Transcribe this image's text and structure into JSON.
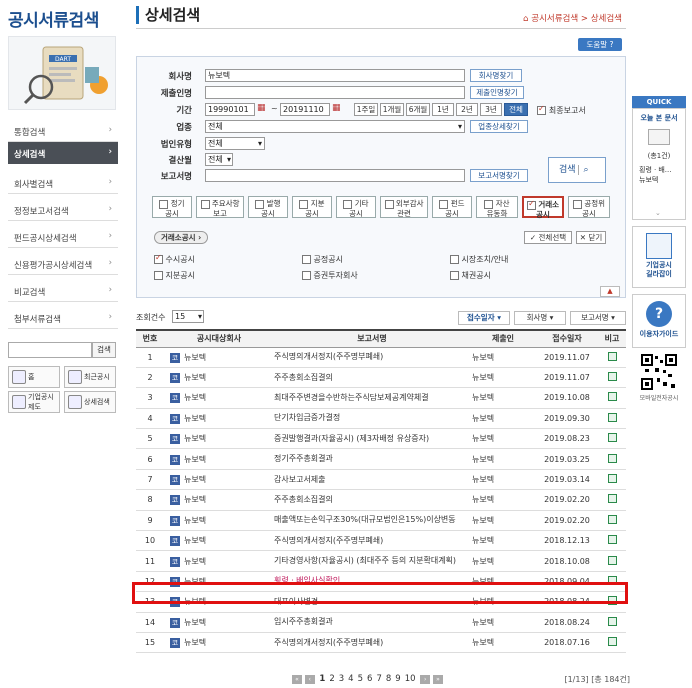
{
  "sidebar": {
    "title": "공시서류검색",
    "logo_text": "DART",
    "items": [
      {
        "label": "통합검색"
      },
      {
        "label": "상세검색"
      },
      {
        "label": "회사별검색"
      },
      {
        "label": "정정보고서검색"
      },
      {
        "label": "펀드공시상세검색"
      },
      {
        "label": "신용평가공시상세검색"
      },
      {
        "label": "비교검색"
      },
      {
        "label": "첨부서류검색"
      }
    ],
    "search_button": "검색",
    "quick_links": [
      {
        "label": "홈"
      },
      {
        "label": "최근공시"
      },
      {
        "label": "기업공시제도"
      },
      {
        "label": "상세검색"
      }
    ]
  },
  "header": {
    "title": "상세검색",
    "breadcrumb": "공시서류검색 > 상세검색",
    "help_button": "도움말"
  },
  "form": {
    "company_label": "회사명",
    "company_value": "뉴보텍",
    "company_search_btn": "회사명찾기",
    "submitter_label": "제출인명",
    "submitter_value": "",
    "submitter_search_btn": "제출인명찾기",
    "period_label": "기간",
    "date_from": "19990101",
    "date_sep": "~",
    "date_to": "20191110",
    "period_buttons": [
      "1주일",
      "1개월",
      "6개월",
      "1년",
      "2년",
      "3년",
      "전체"
    ],
    "latest_report_label": "최종보고서",
    "industry_label": "업종",
    "industry_value": "전체",
    "industry_btn": "업종상세찾기",
    "corp_type_label": "법인유형",
    "corp_type_value": "전체",
    "fiscal_label": "결산월",
    "fiscal_value": "전체",
    "report_label": "보고서명",
    "report_value": "",
    "report_btn": "보고서명찾기",
    "search_button": "검색",
    "types": [
      {
        "label": "정기\n공시"
      },
      {
        "label": "주요사항\n보고"
      },
      {
        "label": "발행\n공시"
      },
      {
        "label": "지분\n공시"
      },
      {
        "label": "기타\n공시"
      },
      {
        "label": "외부감사\n관련"
      },
      {
        "label": "펀드\n공시"
      },
      {
        "label": "자산\n유동화"
      },
      {
        "label": "거래소\n공시"
      },
      {
        "label": "공정위\n공시"
      }
    ],
    "exchange_tag": "거래소공시",
    "select_all": "전체선택",
    "close": "닫기",
    "sub_options": [
      "수시공시",
      "공정공시",
      "시장조치/안내",
      "지분공시",
      "증권투자회사",
      "채권공시"
    ]
  },
  "list": {
    "count_label": "조회건수",
    "count_value": "15",
    "sort_buttons": [
      "접수일자",
      "회사명",
      "보고서명"
    ],
    "columns": [
      "번호",
      "공시대상회사",
      "보고서명",
      "제출인",
      "접수일자",
      "비고"
    ],
    "badge": "코",
    "rows": [
      {
        "no": "1",
        "company": "뉴보텍",
        "report": "주식명의개서정지(주주명부폐쇄)",
        "submitter": "뉴보텍",
        "date": "2019.11.07"
      },
      {
        "no": "2",
        "company": "뉴보텍",
        "report": "주주총회소집결의",
        "submitter": "뉴보텍",
        "date": "2019.11.07"
      },
      {
        "no": "3",
        "company": "뉴보텍",
        "report": "최대주주변경을수반하는주식담보제공계약체결",
        "submitter": "뉴보텍",
        "date": "2019.10.08"
      },
      {
        "no": "4",
        "company": "뉴보텍",
        "report": "단기차입금증가결정",
        "submitter": "뉴보텍",
        "date": "2019.09.30"
      },
      {
        "no": "5",
        "company": "뉴보텍",
        "report": "증권발행결과(자율공시) (제3자배정 유상증자)",
        "submitter": "뉴보텍",
        "date": "2019.08.23"
      },
      {
        "no": "6",
        "company": "뉴보텍",
        "report": "정기주주총회결과",
        "submitter": "뉴보텍",
        "date": "2019.03.25"
      },
      {
        "no": "7",
        "company": "뉴보텍",
        "report": "감사보고서제출",
        "submitter": "뉴보텍",
        "date": "2019.03.14"
      },
      {
        "no": "8",
        "company": "뉴보텍",
        "report": "주주총회소집결의",
        "submitter": "뉴보텍",
        "date": "2019.02.20"
      },
      {
        "no": "9",
        "company": "뉴보텍",
        "report": "매출액또는손익구조30%(대규모법인은15%)이상변동",
        "submitter": "뉴보텍",
        "date": "2019.02.20"
      },
      {
        "no": "10",
        "company": "뉴보텍",
        "report": "주식명의개서정지(주주명부폐쇄)",
        "submitter": "뉴보텍",
        "date": "2018.12.13"
      },
      {
        "no": "11",
        "company": "뉴보텍",
        "report": "기타경영사항(자율공시) (최대주주 등의 지분확대계획)",
        "submitter": "뉴보텍",
        "date": "2018.10.08"
      },
      {
        "no": "12",
        "company": "뉴보텍",
        "report": "횡령ㆍ배임사실확인",
        "submitter": "뉴보텍",
        "date": "2018.09.04"
      },
      {
        "no": "13",
        "company": "뉴보텍",
        "report": "대표이사변경",
        "submitter": "뉴보텍",
        "date": "2018.08.24"
      },
      {
        "no": "14",
        "company": "뉴보텍",
        "report": "임시주주총회결과",
        "submitter": "뉴보텍",
        "date": "2018.08.24"
      },
      {
        "no": "15",
        "company": "뉴보텍",
        "report": "주식명의개서정지(주주명부폐쇄)",
        "submitter": "뉴보텍",
        "date": "2018.07.16"
      }
    ],
    "pages": [
      "1",
      "2",
      "3",
      "4",
      "5",
      "6",
      "7",
      "8",
      "9",
      "10"
    ],
    "page_info": "[1/13] [총 184건]"
  },
  "quick": {
    "title": "QUICK",
    "today_doc": "오늘 본 문서",
    "count": "(총1건)",
    "recent_item": "횡령ㆍ배...\n뉴보텍",
    "guide1": "기업공시\n길라잡이",
    "guide2": "이용자가이드",
    "mobile": "모바일전자공시"
  },
  "colors": {
    "accent": "#1c4f8f",
    "highlight": "#e01010",
    "active_nav": "#4a4f56"
  }
}
